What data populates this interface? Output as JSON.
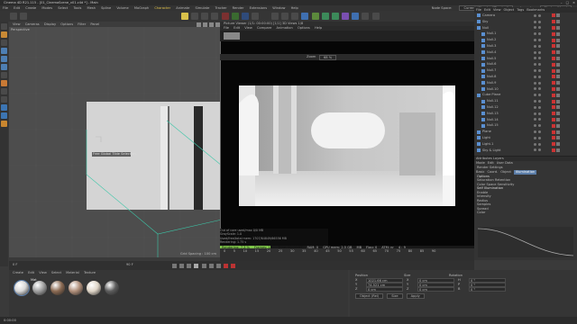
{
  "app": {
    "title": "Cinema 4D R21.115 - [01_CinemaScene_v01.c4d *] - Main",
    "window_controls": [
      "–",
      "□",
      "×"
    ]
  },
  "menubar": {
    "items": [
      "File",
      "Edit",
      "Create",
      "Modes",
      "Select",
      "Tools",
      "Mesh",
      "Spline",
      "Volume",
      "MoGraph",
      "Character",
      "Animate",
      "Simulate",
      "Tracker",
      "Render",
      "Extensions",
      "Window",
      "Help"
    ],
    "highlight_index": 10,
    "layout_label": "Node Space:",
    "node_space": "Current (Standard/Physical)",
    "layout_title": "Layout:",
    "layout_value": "Startup (User)"
  },
  "viewport": {
    "menu": [
      "View",
      "Cameras",
      "Display",
      "Options",
      "Filter",
      "Panel"
    ],
    "label": "Perspective",
    "tooltip": "Free Global Tilde Selection",
    "grid_spacing": "Grid Spacing : 100 cm"
  },
  "picture_viewer": {
    "title": "Picture Viewer (1/1: 00:00:00) [1/1] 3D Views 1/8",
    "menu": [
      "File",
      "Edit",
      "View",
      "Compare",
      "Animation",
      "Options",
      "Help"
    ],
    "zoom": "68 %",
    "zoom_label": "Zoom",
    "info_lines": [
      "Out of core used/max 0/0 MB",
      "GrayScale: 1.0",
      "Used/free/total mem: 1707/64849/66556 MB",
      "Rendering: 1.75 s"
    ],
    "info_highlight": "Rendered: 1.75 s  Rendering: 1.0",
    "status_items": [
      "Rendering: 7.3 %",
      "Frames: 1/1",
      "Time: 00:00:07",
      "RAM: 0",
      "GPU mem: 2.5 GB",
      "MB",
      "Flag: 0",
      "ATM: nr",
      "4 : 9"
    ],
    "progress": 0.2
  },
  "objects": {
    "menu": [
      "File",
      "Edit",
      "View",
      "Object",
      "Tags",
      "Bookmarks"
    ],
    "rows": [
      {
        "name": "Camera",
        "indent": 0
      },
      {
        "name": "Sky",
        "indent": 0
      },
      {
        "name": "Null",
        "indent": 0
      },
      {
        "name": "Null.1",
        "indent": 1
      },
      {
        "name": "Null.2",
        "indent": 1
      },
      {
        "name": "Null.3",
        "indent": 1
      },
      {
        "name": "Null.4",
        "indent": 1
      },
      {
        "name": "Null.5",
        "indent": 1
      },
      {
        "name": "Null.6",
        "indent": 1
      },
      {
        "name": "Null.7",
        "indent": 1
      },
      {
        "name": "Null.8",
        "indent": 1
      },
      {
        "name": "Null.9",
        "indent": 1
      },
      {
        "name": "Null.10",
        "indent": 1
      },
      {
        "name": "Cube Plane",
        "indent": 0
      },
      {
        "name": "Null.11",
        "indent": 1
      },
      {
        "name": "Null.12",
        "indent": 1
      },
      {
        "name": "Null.13",
        "indent": 1
      },
      {
        "name": "Null.14",
        "indent": 1
      },
      {
        "name": "Null.15",
        "indent": 1
      },
      {
        "name": "Plane",
        "indent": 0
      },
      {
        "name": "Light",
        "indent": 0
      },
      {
        "name": "Light.1",
        "indent": 0
      },
      {
        "name": "Sky & Light",
        "indent": 0
      }
    ]
  },
  "attributes": {
    "header": "Attributes  Layers",
    "menu": [
      "Mode",
      "Edit",
      "User Data"
    ],
    "object_label": "Render Settings",
    "tabs": [
      "Basic",
      "Coord.",
      "Object",
      "Illumination"
    ],
    "active_tab": 3,
    "section": "Options",
    "lines": [
      "Saturation Retention",
      "Color Space Sensitivity",
      "Self Illumination",
      "Enable",
      "Intensity",
      "Radius",
      "Samples",
      "Spread",
      "Color"
    ]
  },
  "timeline": {
    "ticks": [
      "0",
      "5",
      "10",
      "15",
      "20",
      "25",
      "30",
      "35",
      "40",
      "45",
      "50",
      "55",
      "60",
      "65",
      "70",
      "75",
      "80",
      "85",
      "90"
    ],
    "start": "0 F",
    "end": "90 F"
  },
  "materials": {
    "menu": [
      "Create",
      "Edit",
      "View",
      "Select",
      "Material",
      "Texture"
    ],
    "balls": [
      "#d8d8d8",
      "#a0a0a0",
      "#8b6a52",
      "#b08f7a",
      "#e0d6c8",
      "#5c5c5c"
    ],
    "selected_label": "Mat"
  },
  "coordinates": {
    "headers": [
      "Position",
      "Size",
      "Rotation"
    ],
    "rows": [
      {
        "axis": "X",
        "pos": "1021.66 cm",
        "size": "0 cm",
        "rot_axis": "H",
        "rot": "0 °"
      },
      {
        "axis": "Y",
        "pos": "74.521 cm",
        "size": "0 cm",
        "rot_axis": "P",
        "rot": "0 °"
      },
      {
        "axis": "Z",
        "pos": "0 cm",
        "size": "0 cm",
        "rot_axis": "B",
        "rot": "0 °"
      }
    ],
    "mode": "Object (Rel)",
    "size_mode": "Size",
    "apply": "Apply"
  },
  "statusbar": {
    "text": "0:00:00"
  },
  "colors": {
    "accent": "#5b7da8",
    "progress": "#7fc64a",
    "info_highlight": "#e39a2f",
    "menu_highlight": "#e3c34a"
  }
}
